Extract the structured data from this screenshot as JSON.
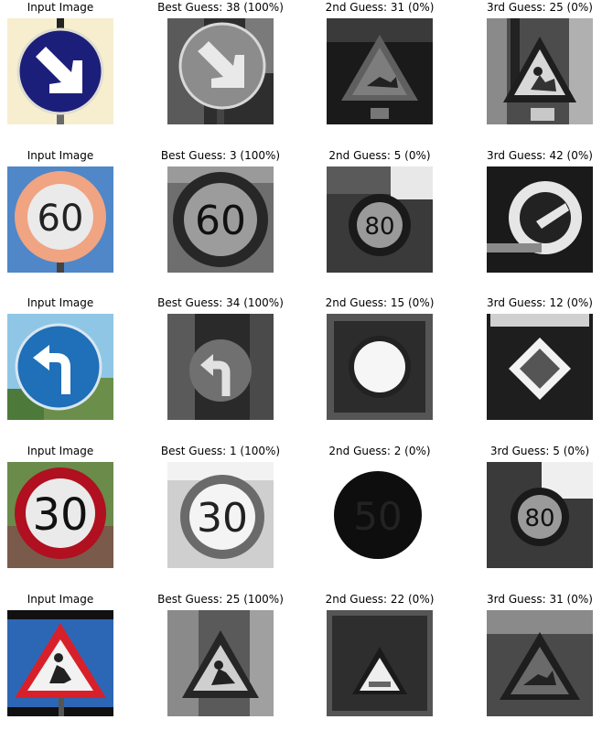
{
  "rows": [
    {
      "titles": [
        "Input Image",
        "Best Guess: 38 (100%)",
        "2nd Guess: 31 (0%)",
        "3rd Guess: 25 (0%)"
      ]
    },
    {
      "titles": [
        "Input Image",
        "Best Guess: 3 (100%)",
        "2nd Guess: 5 (0%)",
        "3rd Guess: 42 (0%)"
      ]
    },
    {
      "titles": [
        "Input Image",
        "Best Guess: 34 (100%)",
        "2nd Guess: 15 (0%)",
        "3rd Guess: 12 (0%)"
      ]
    },
    {
      "titles": [
        "Input Image",
        "Best Guess: 1 (100%)",
        "2nd Guess: 2 (0%)",
        "3rd Guess: 5 (0%)"
      ]
    },
    {
      "titles": [
        "Input Image",
        "Best Guess: 25 (100%)",
        "2nd Guess: 22 (0%)",
        "3rd Guess: 31 (0%)"
      ]
    }
  ],
  "sign_numbers": {
    "speed_60_input": "60",
    "speed_60_guess": "60",
    "speed_80_guess": "80",
    "speed_30_input": "30",
    "speed_30_guess": "30",
    "speed_50_guess": "50",
    "speed_80_guess_b": "80"
  }
}
